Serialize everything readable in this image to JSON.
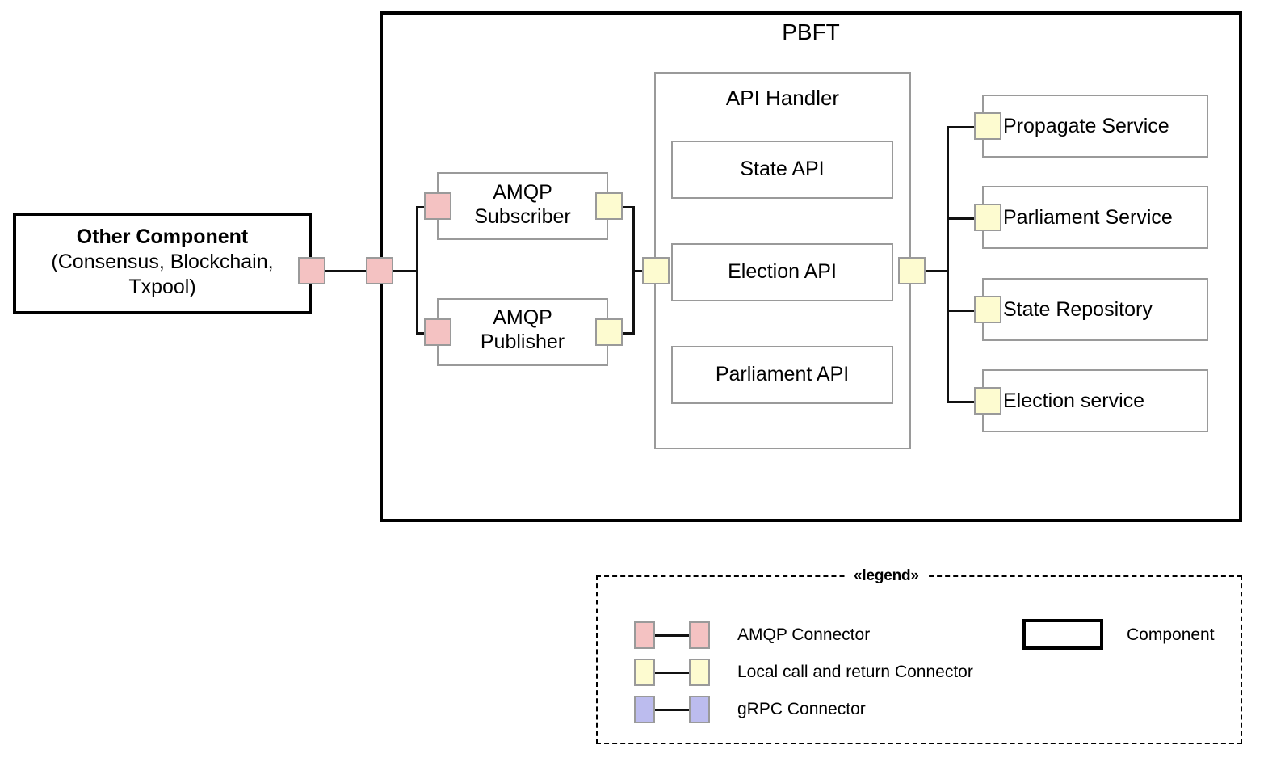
{
  "diagram": {
    "title": "PBFT",
    "external_component": {
      "line1": "Other Component",
      "line2": "(Consensus, Blockchain,",
      "line3": "Txpool)"
    },
    "messaging": [
      {
        "id": "amqp-subscriber",
        "line1": "AMQP",
        "line2": "Subscriber"
      },
      {
        "id": "amqp-publisher",
        "line1": "AMQP",
        "line2": "Publisher"
      }
    ],
    "api_handler": {
      "title": "API Handler",
      "apis": [
        {
          "id": "state-api",
          "label": "State API"
        },
        {
          "id": "election-api",
          "label": "Election API"
        },
        {
          "id": "parliament-api",
          "label": "Parliament API"
        }
      ]
    },
    "services": [
      {
        "id": "propagate-service",
        "label": "Propagate Service"
      },
      {
        "id": "parliament-service",
        "label": "Parliament Service"
      },
      {
        "id": "state-repository",
        "label": "State Repository"
      },
      {
        "id": "election-service",
        "label": "Election service"
      }
    ]
  },
  "legend": {
    "title": "«legend»",
    "rows": [
      {
        "id": "amqp-connector",
        "label": "AMQP Connector",
        "color": "#f4c2c2"
      },
      {
        "id": "local-call-connector",
        "label": "Local call and return Connector",
        "color": "#fdfbd0"
      },
      {
        "id": "grpc-connector",
        "label": "gRPC Connector",
        "color": "#bcbcee"
      }
    ],
    "component": {
      "id": "component",
      "label": "Component"
    }
  },
  "colors": {
    "amqp": "#f4c2c2",
    "local_call": "#fdfbd0",
    "grpc": "#bcbcee",
    "border_thin": "#9a9a9a",
    "border_thick": "#000000",
    "line": "#111111"
  }
}
